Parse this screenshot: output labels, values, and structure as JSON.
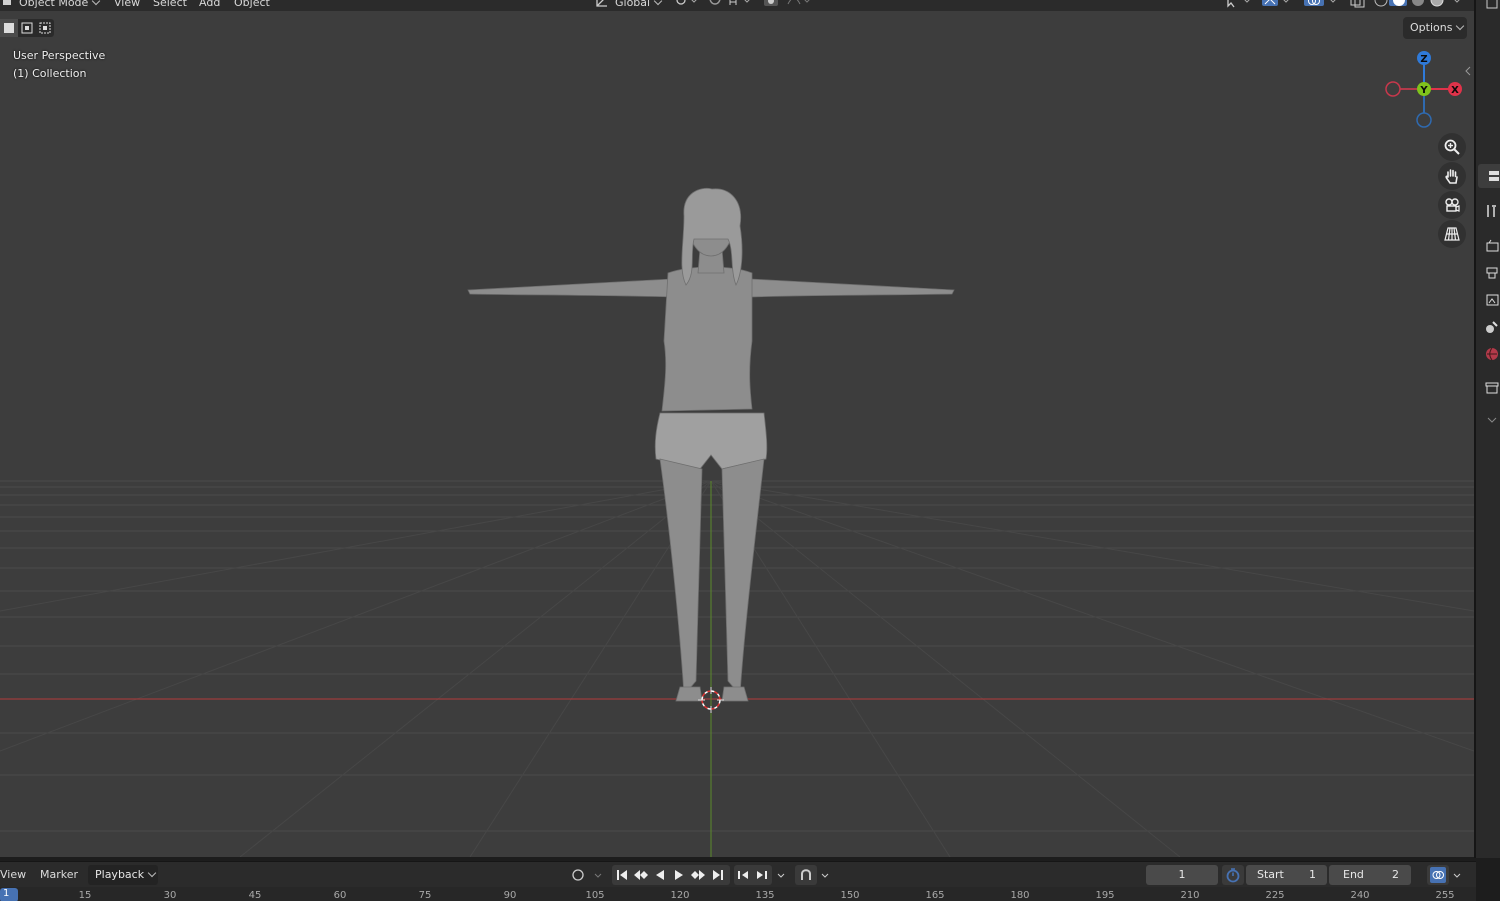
{
  "header": {
    "mode_label": "Object Mode",
    "menu": [
      "View",
      "Select",
      "Add",
      "Object"
    ],
    "orientation_label": "Global"
  },
  "viewport": {
    "perspective_label": "User Perspective",
    "collection_label": "(1) Collection",
    "options_label": "Options",
    "gizmo": {
      "z": "Z",
      "y": "Y",
      "x": "X"
    }
  },
  "timeline": {
    "menu": [
      "View",
      "Marker"
    ],
    "playback_label": "Playback",
    "current_frame": "1",
    "start_label": "Start",
    "start_value": "1",
    "end_label": "End",
    "end_value": "2",
    "ruler_current": "1",
    "ruler_ticks": [
      "15",
      "30",
      "45",
      "60",
      "75",
      "90",
      "105",
      "120",
      "135",
      "150",
      "165",
      "180",
      "195",
      "210",
      "225",
      "240",
      "255"
    ]
  },
  "colors": {
    "x_axis": "#e0334a",
    "y_axis": "#7fc31c",
    "z_axis": "#2f7ad9",
    "accent": "#4772b3"
  }
}
